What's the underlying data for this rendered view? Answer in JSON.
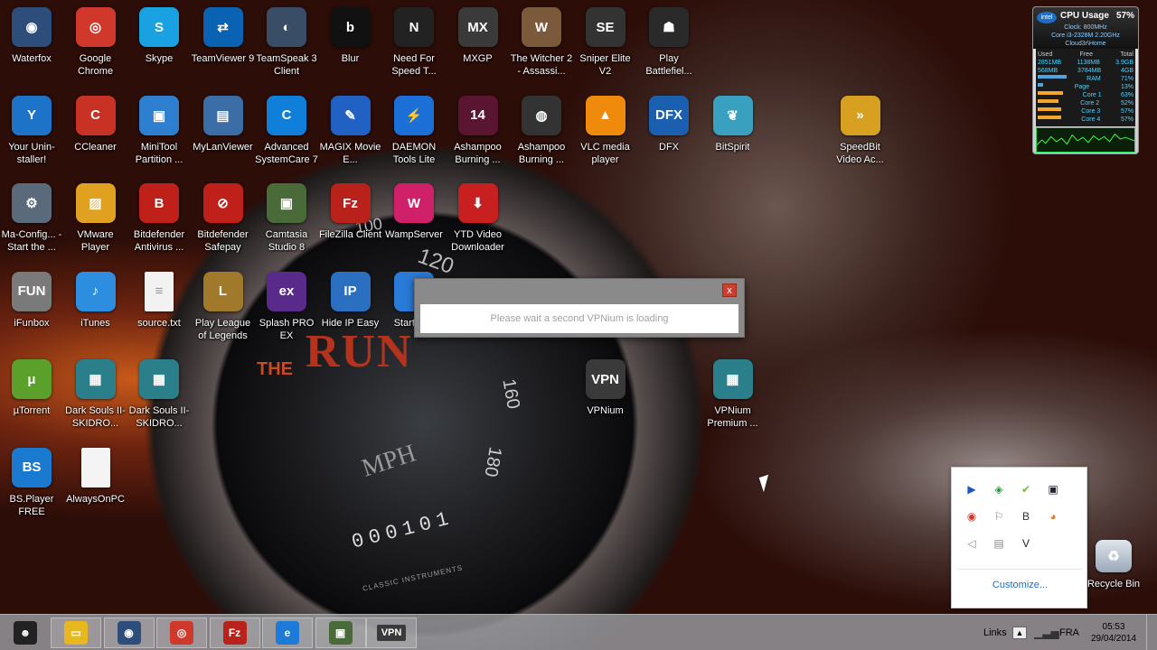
{
  "desktop": {
    "icons": [
      {
        "label": "Waterfox",
        "icon": "globe-icon",
        "color": "#2d4d7a",
        "glyph": "◉"
      },
      {
        "label": "Google Chrome",
        "icon": "chrome-icon",
        "color": "#d0382c",
        "glyph": "◎"
      },
      {
        "label": "Skype",
        "icon": "skype-icon",
        "color": "#1aa1e1",
        "glyph": "S"
      },
      {
        "label": "TeamViewer 9",
        "icon": "teamviewer-icon",
        "color": "#0a62b3",
        "glyph": "⇄"
      },
      {
        "label": "TeamSpeak 3 Client",
        "icon": "teamspeak-icon",
        "color": "#3a4d66",
        "glyph": "◐"
      },
      {
        "label": "Blur",
        "icon": "blur-icon",
        "color": "#111",
        "glyph": "b"
      },
      {
        "label": "Need For Speed T...",
        "icon": "nfs-icon",
        "color": "#222",
        "glyph": "N"
      },
      {
        "label": "MXGP",
        "icon": "mxgp-icon",
        "color": "#3a3a3a",
        "glyph": "MX"
      },
      {
        "label": "The Witcher 2 - Assassi...",
        "icon": "witcher-icon",
        "color": "#7a5a3a",
        "glyph": "W"
      },
      {
        "label": "Sniper Elite V2",
        "icon": "sniper-icon",
        "color": "#333",
        "glyph": "SE"
      },
      {
        "label": "Play Battlefiel...",
        "icon": "battlefield-icon",
        "color": "#2a2a2a",
        "glyph": "☗"
      },
      {
        "label": "Your Unin-staller!",
        "icon": "uninstaller-icon",
        "color": "#1c73c8",
        "glyph": "Y"
      },
      {
        "label": "CCleaner",
        "icon": "ccleaner-icon",
        "color": "#c83224",
        "glyph": "C"
      },
      {
        "label": "MiniTool Partition ...",
        "icon": "minitool-icon",
        "color": "#2f7fd0",
        "glyph": "▣"
      },
      {
        "label": "MyLanViewer",
        "icon": "lanviewer-icon",
        "color": "#3b6da6",
        "glyph": "▤"
      },
      {
        "label": "Advanced SystemCare 7",
        "icon": "systemcare-icon",
        "color": "#0f7fd9",
        "glyph": "C"
      },
      {
        "label": "MAGIX Movie E...",
        "icon": "magix-icon",
        "color": "#2161c4",
        "glyph": "✎"
      },
      {
        "label": "DAEMON Tools Lite",
        "icon": "daemon-icon",
        "color": "#1d6fd8",
        "glyph": "⚡"
      },
      {
        "label": "Ashampoo Burning ...",
        "icon": "ashampoo-icon",
        "color": "#5a1530",
        "glyph": "14"
      },
      {
        "label": "Ashampoo Burning ...",
        "icon": "ashampoo-compact-icon",
        "color": "#333",
        "glyph": "◍"
      },
      {
        "label": "VLC media player",
        "icon": "vlc-icon",
        "color": "#f08a0c",
        "glyph": "▲"
      },
      {
        "label": "DFX",
        "icon": "dfx-icon",
        "color": "#1a5fb0",
        "glyph": "DFX"
      },
      {
        "label": "BitSpirit",
        "icon": "bitspirit-icon",
        "color": "#3aa0c0",
        "glyph": "❦"
      },
      {
        "label": "SpeedBit Video Ac...",
        "icon": "speedbit-icon",
        "color": "#d8a020",
        "glyph": "»"
      },
      {
        "label": "Ma-Config... - Start the ...",
        "icon": "maconfig-icon",
        "color": "#5a6a7a",
        "glyph": "⚙"
      },
      {
        "label": "VMware Player",
        "icon": "vmware-icon",
        "color": "#e0a020",
        "glyph": "▨"
      },
      {
        "label": "Bitdefender Antivirus ...",
        "icon": "bitdefender-icon",
        "color": "#c0201a",
        "glyph": "B"
      },
      {
        "label": "Bitdefender Safepay",
        "icon": "safepay-icon",
        "color": "#c0201a",
        "glyph": "⊘"
      },
      {
        "label": "Camtasia Studio 8",
        "icon": "camtasia-icon",
        "color": "#4a6a3a",
        "glyph": "▣"
      },
      {
        "label": "FileZilla Client",
        "icon": "filezilla-icon",
        "color": "#b8221a",
        "glyph": "Fz"
      },
      {
        "label": "WampServer",
        "icon": "wamp-icon",
        "color": "#d0206a",
        "glyph": "W"
      },
      {
        "label": "YTD Video Downloader",
        "icon": "ytd-icon",
        "color": "#c82020",
        "glyph": "⬇"
      },
      {
        "label": "iFunbox",
        "icon": "ifunbox-icon",
        "color": "#7a7a7a",
        "glyph": "FUN"
      },
      {
        "label": "iTunes",
        "icon": "itunes-icon",
        "color": "#2d8ee0",
        "glyph": "♪"
      },
      {
        "label": "source.txt",
        "icon": "text-file-icon",
        "color": "#f2f2f2",
        "glyph": "≡"
      },
      {
        "label": "Play League of Legends",
        "icon": "lol-icon",
        "color": "#a07a2a",
        "glyph": "L"
      },
      {
        "label": "Splash PRO EX",
        "icon": "splash-icon",
        "color": "#5a2a8a",
        "glyph": "ex"
      },
      {
        "label": "Hide IP Easy",
        "icon": "hideip-icon",
        "color": "#2a6fc0",
        "glyph": "IP"
      },
      {
        "label": "Start M...",
        "icon": "startmenu-icon",
        "color": "#2a7ad8",
        "glyph": "◔"
      },
      {
        "label": "µTorrent",
        "icon": "utorrent-icon",
        "color": "#5aa02a",
        "glyph": "μ"
      },
      {
        "label": "Dark Souls II-SKIDRO...",
        "icon": "rar-icon",
        "color": "#2a7f8a",
        "glyph": "▦"
      },
      {
        "label": "Dark Souls II-SKIDRO...",
        "icon": "rar-icon",
        "color": "#2a7f8a",
        "glyph": "▦"
      },
      {
        "label": "VPNium",
        "icon": "vpn-icon",
        "color": "#3a3a3a",
        "glyph": "VPN"
      },
      {
        "label": "VPNium Premium ...",
        "icon": "rar-icon",
        "color": "#2a7f8a",
        "glyph": "▦"
      },
      {
        "label": "BS.Player FREE",
        "icon": "bsplayer-icon",
        "color": "#1a7ad0",
        "glyph": "BS"
      },
      {
        "label": "AlwaysOnPC",
        "icon": "blank-file-icon",
        "color": "#f4f4f4",
        "glyph": ""
      }
    ]
  },
  "gauge": {
    "the": "THE",
    "run": "RUN",
    "mph": "MPH",
    "odometer": "000101",
    "classic": "CLASSIC INSTRUMENTS",
    "n100": "100",
    "n120": "120",
    "n160": "160",
    "n180": "180"
  },
  "dialog": {
    "close": "x",
    "message": "Please wait a second  VPNium is loading"
  },
  "gadget": {
    "brand": "intel",
    "title": "CPU Usage",
    "percent": "57%",
    "clock": "Clock:  800MHz",
    "model": "Core i3-2328M 2.20GHz",
    "host": "Cloud3r\\Home",
    "headers": [
      "Used",
      "Free",
      "Total"
    ],
    "mem": [
      [
        "2851MB",
        "1138MB",
        "3.9GB"
      ],
      [
        "568MB",
        "3784MB",
        "4GB"
      ]
    ],
    "bars": [
      {
        "label": "RAM",
        "value": "71%"
      },
      {
        "label": "Page",
        "value": "13%"
      },
      {
        "label": "Core 1",
        "value": "63%"
      },
      {
        "label": "Core 2",
        "value": "52%"
      },
      {
        "label": "Core 3",
        "value": "57%"
      },
      {
        "label": "Core 4",
        "value": "57%"
      }
    ]
  },
  "tray": {
    "icons": [
      {
        "name": "play-arrow-icon",
        "glyph": "▶",
        "color": "#1a56c8"
      },
      {
        "name": "network-icon",
        "glyph": "◈",
        "color": "#2a9a3a"
      },
      {
        "name": "check-icon",
        "glyph": "✔",
        "color": "#7ab63a"
      },
      {
        "name": "monitor-icon",
        "glyph": "▣",
        "color": "#223"
      },
      {
        "name": "chrome-icon",
        "glyph": "◉",
        "color": "#d0382c"
      },
      {
        "name": "flag-icon",
        "glyph": "⚐",
        "color": "#888"
      },
      {
        "name": "bitdefender-icon",
        "glyph": "B",
        "color": "#333"
      },
      {
        "name": "speedbit-icon",
        "glyph": "◕",
        "color": "#e07a1a"
      },
      {
        "name": "speaker-icon",
        "glyph": "◁",
        "color": "#888"
      },
      {
        "name": "archive-icon",
        "glyph": "▤",
        "color": "#888"
      },
      {
        "name": "v-icon",
        "glyph": "V",
        "color": "#222"
      }
    ],
    "customize": "Customize..."
  },
  "recycle": {
    "label": "Recycle Bin"
  },
  "taskbar": {
    "links": "Links",
    "lang": "FRA",
    "time": "05:53",
    "date": "29/04/2014",
    "vpn": "VPN",
    "apps": [
      {
        "name": "start-mask-icon",
        "glyph": "☻",
        "color": "#222"
      },
      {
        "name": "explorer-icon",
        "glyph": "▭",
        "color": "#e8b820"
      },
      {
        "name": "waterfox-icon",
        "glyph": "◉",
        "color": "#2d4d7a"
      },
      {
        "name": "chrome-icon",
        "glyph": "◎",
        "color": "#d0382c"
      },
      {
        "name": "filezilla-icon",
        "glyph": "Fz",
        "color": "#b8221a"
      },
      {
        "name": "ie-icon",
        "glyph": "e",
        "color": "#1e7ad8"
      },
      {
        "name": "camtasia-icon",
        "glyph": "▣",
        "color": "#4a6a3a"
      }
    ]
  }
}
